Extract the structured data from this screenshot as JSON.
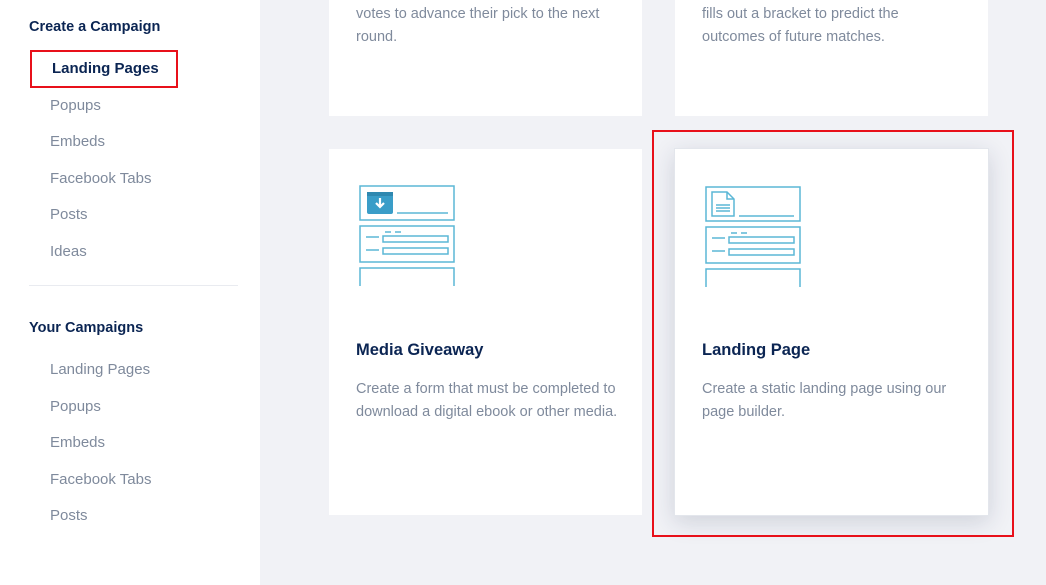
{
  "sidebar": {
    "create_title": "Create a Campaign",
    "create_items": [
      {
        "label": "Landing Pages"
      },
      {
        "label": "Popups"
      },
      {
        "label": "Embeds"
      },
      {
        "label": "Facebook Tabs"
      },
      {
        "label": "Posts"
      },
      {
        "label": "Ideas"
      }
    ],
    "your_title": "Your Campaigns",
    "your_items": [
      {
        "label": "Landing Pages"
      },
      {
        "label": "Popups"
      },
      {
        "label": "Embeds"
      },
      {
        "label": "Facebook Tabs"
      },
      {
        "label": "Posts"
      }
    ]
  },
  "cards": {
    "top_left_desc": "votes to advance their pick to the next round.",
    "top_right_desc": "fills out a bracket to predict the outcomes of future matches.",
    "media_giveaway": {
      "title": "Media Giveaway",
      "desc": "Create a form that must be completed to download a digital ebook or other media.",
      "icon": "download-form-icon"
    },
    "landing_page": {
      "title": "Landing Page",
      "desc": "Create a static landing page using our page builder.",
      "icon": "document-form-icon"
    }
  },
  "colors": {
    "brand_navy": "#0b2553",
    "muted_text": "#7f8a9c",
    "icon_blue": "#5bb7d6",
    "highlight_red": "#e8101a",
    "background": "#f1f2f6"
  }
}
